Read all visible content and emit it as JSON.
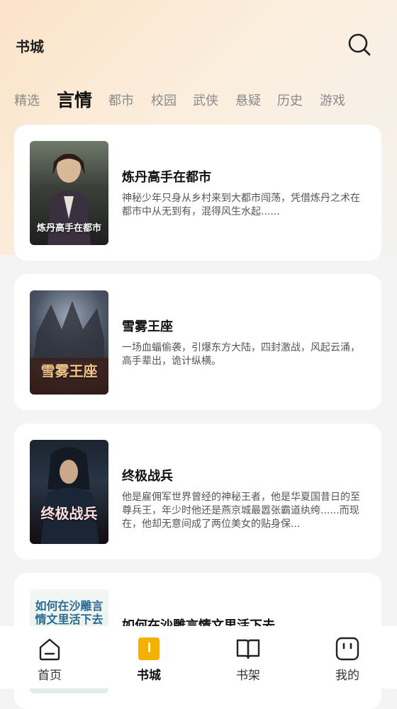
{
  "header": {
    "title": "书城",
    "search_icon": "search-icon"
  },
  "tabs": [
    "精选",
    "言情",
    "都市",
    "校园",
    "武侠",
    "悬疑",
    "历史",
    "游戏"
  ],
  "active_tab": "言情",
  "books": [
    {
      "title": "炼丹高手在都市",
      "description": "神秘少年只身从乡村来到大都市闯荡，凭借炼丹之术在都市中从无到有，混得风生水起......",
      "cover_text": "炼丹高手在都市"
    },
    {
      "title": "雪雾王座",
      "description": "一场血蝠偷袭，引爆东方大陆，四封激战，风起云涌，高手辈出，诡计纵横。",
      "cover_text": "雪雾王座"
    },
    {
      "title": "终极战兵",
      "description": "他是雇佣军世界曾经的神秘王者，他是华夏国昔日的至尊兵王，年少时他还是燕京城最嚣张霸道纨绔......而现在，他却无意间成了两位美女的贴身保...",
      "cover_text": "终极战兵"
    },
    {
      "title": "如何在沙雕言情文里活下去",
      "description": "",
      "cover_text": "如何在沙雕言情文里活下去"
    }
  ],
  "bottom_nav": [
    {
      "label": "首页",
      "icon": "home-icon"
    },
    {
      "label": "书城",
      "icon": "bookstore-icon"
    },
    {
      "label": "书架",
      "icon": "bookshelf-icon"
    },
    {
      "label": "我的",
      "icon": "profile-icon"
    }
  ],
  "active_nav": "书城",
  "colors": {
    "accent": "#f5b000",
    "card": "#ffffff",
    "background": "#f4f4f4"
  }
}
